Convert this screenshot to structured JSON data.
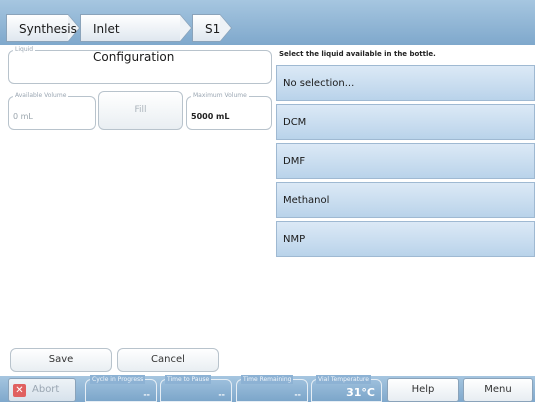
{
  "breadcrumb": [
    "Synthesis",
    "Inlet Configuration",
    "S1"
  ],
  "liquid": {
    "legend": "Liquid",
    "value": ""
  },
  "available_volume": {
    "legend": "Available Volume",
    "value": "0 mL"
  },
  "fill_label": "Fill",
  "maximum_volume": {
    "legend": "Maximum Volume",
    "value": "5000 mL"
  },
  "instruction": "Select the liquid available in the bottle.",
  "options": [
    "No selection...",
    "DCM",
    "DMF",
    "Methanol",
    "NMP"
  ],
  "save_label": "Save",
  "cancel_label": "Cancel",
  "abort_label": "Abort",
  "status": {
    "cycle_in_progress": {
      "legend": "Cycle in Progress",
      "value": "--"
    },
    "time_to_pause": {
      "legend": "Time to Pause",
      "value": "--"
    },
    "time_remaining": {
      "legend": "Time Remaining",
      "value": "--"
    },
    "vial_temperature": {
      "legend": "Vial Temperature",
      "value": "31°C"
    }
  },
  "help_label": "Help",
  "menu_label": "Menu"
}
